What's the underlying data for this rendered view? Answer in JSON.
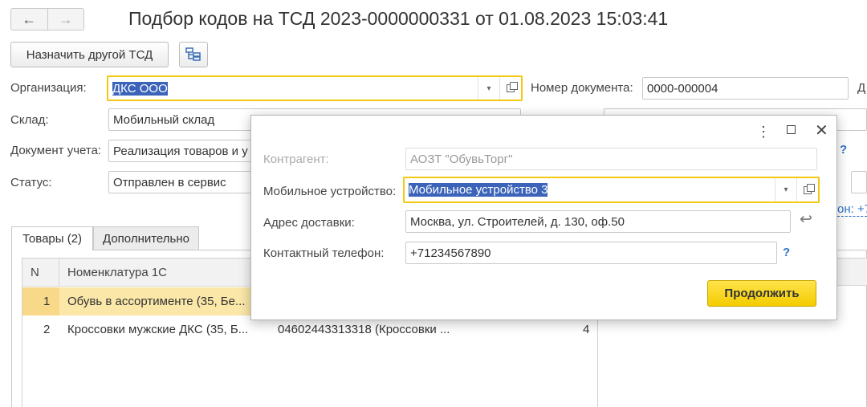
{
  "header": {
    "title": "Подбор кодов на ТСД 2023-0000000331 от 01.08.2023 15:03:41",
    "back_icon": "arrow-left",
    "forward_icon": "arrow-right"
  },
  "toolbar": {
    "assign_button": "Назначить другой ТСД",
    "structure_icon": "structure-icon"
  },
  "form": {
    "org_label": "Организация:",
    "org_value": "ДКС ООО",
    "warehouse_label": "Склад:",
    "warehouse_value": "Мобильный склад",
    "doc_label": "Документ учета:",
    "doc_value": "Реализация товаров и у",
    "status_label": "Статус:",
    "status_value": "Отправлен в сервис",
    "docnum_label": "Номер документа:",
    "docnum_value": "0000-000004",
    "cut_label_d": "Д",
    "cut_q": "?",
    "cut_link": "он: +7"
  },
  "tabs": [
    {
      "label": "Товары (2)",
      "active": true
    },
    {
      "label": "Дополнительно",
      "active": false
    }
  ],
  "table": {
    "columns": [
      "N",
      "Номенклатура 1С"
    ],
    "rows": [
      {
        "n": "1",
        "name": "Обувь в ассортименте (35, Бе...",
        "code": "",
        "qty": ""
      },
      {
        "n": "2",
        "name": "Кроссовки мужские ДКС (35, Б...",
        "code": "04602443313318 (Кроссовки ...",
        "qty": "4"
      }
    ]
  },
  "dialog": {
    "menu_icon": "more-vertical-icon",
    "maximize_icon": "maximize-icon",
    "close_icon": "close-icon",
    "contractor_label": "Контрагент:",
    "contractor_value": "АОЗТ \"ОбувьТорг\"",
    "device_label": "Мобильное устройство:",
    "device_value": "Мобильное устройство 3",
    "address_label": "Адрес доставки:",
    "address_value": "Москва, ул. Строителей, д. 130, оф.50",
    "phone_label": "Контактный телефон:",
    "phone_value": "+71234567890",
    "phone_help": "?",
    "continue_button": "Продолжить"
  },
  "colors": {
    "focus": "#f2c811",
    "selection": "#3b63b9",
    "primary_button": "#f3cc00",
    "selected_row": "#fbe7a8"
  }
}
